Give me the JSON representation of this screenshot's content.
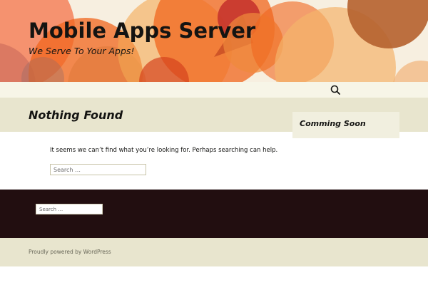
{
  "header": {
    "site_title": "Mobile Apps Server",
    "tagline": "We Serve To Your Apps!"
  },
  "nav": {
    "search_icon": "search-icon"
  },
  "page": {
    "title": "Nothing Found",
    "message": "It seems we can’t find what you’re looking for. Perhaps searching can help.",
    "search_placeholder": "Search …"
  },
  "sidebar": {
    "widget_title": "Comming Soon"
  },
  "footer": {
    "search_placeholder": "Search …",
    "credit": "Proudly powered by WordPress"
  },
  "colors": {
    "header_bg": "#f7efe0",
    "nav_bg": "#f7f5e7",
    "band_bg": "#e8e5ce",
    "footer_dark": "#220e10",
    "accent_orange": "#f0661e"
  }
}
